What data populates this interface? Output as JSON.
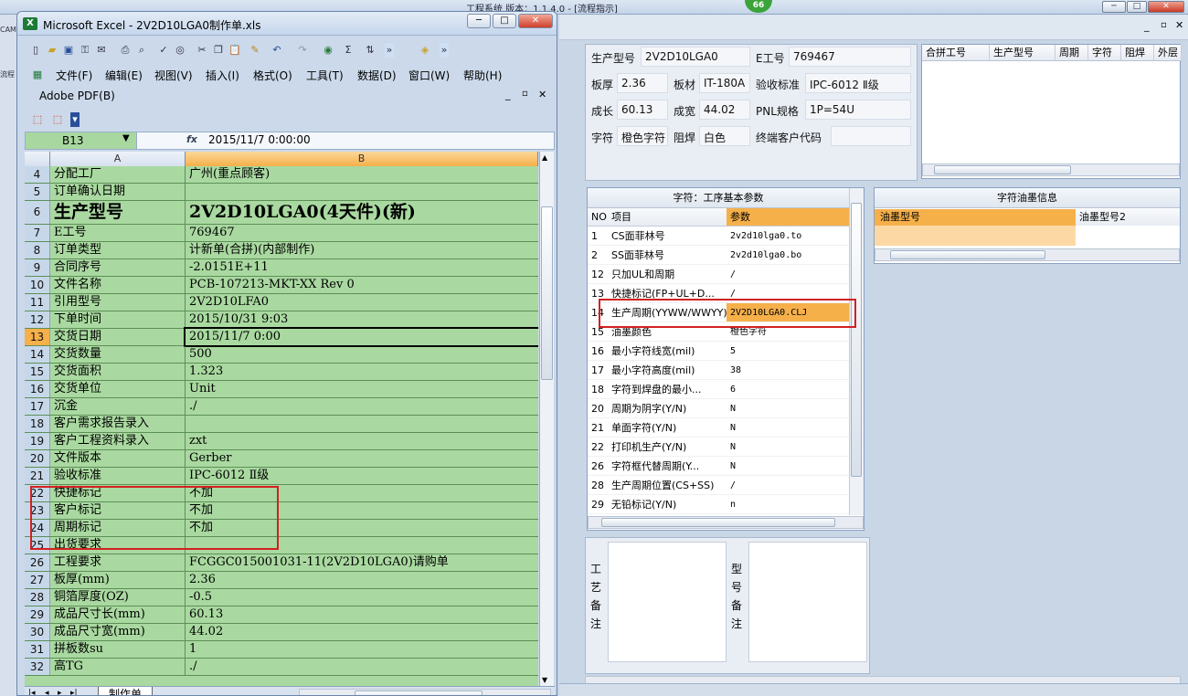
{
  "app": {
    "title": "工程系统   版本：1.1.4.0 - [流程指示]",
    "badge": "66",
    "left_labels": [
      "CAM",
      "流程"
    ]
  },
  "excel": {
    "title": "Microsoft Excel - 2V2D10LGA0制作单.xls",
    "menus": [
      "文件(F)",
      "编辑(E)",
      "视图(V)",
      "插入(I)",
      "格式(O)",
      "工具(T)",
      "数据(D)",
      "窗口(W)",
      "帮助(H)"
    ],
    "adobe": "Adobe PDF(B)",
    "name_box": "B13",
    "formula_value": "2015/11/7  0:00:00",
    "columns": [
      "A",
      "B"
    ],
    "sheet_tab": "制作单",
    "rows": [
      {
        "n": "4",
        "a": "分配工厂",
        "b": "广州(重点顾客)"
      },
      {
        "n": "5",
        "a": "订单确认日期",
        "b": ""
      },
      {
        "n": "6",
        "a": "生产型号",
        "b": "2V2D10LGA0(4天件)(新)"
      },
      {
        "n": "7",
        "a": "E工号",
        "b": "769467"
      },
      {
        "n": "8",
        "a": "订单类型",
        "b": "计新单(合拼)(内部制作)"
      },
      {
        "n": "9",
        "a": "合同序号",
        "b": "-2.0151E+11"
      },
      {
        "n": "10",
        "a": "文件名称",
        "b": "PCB-107213-MKT-XX Rev 0"
      },
      {
        "n": "11",
        "a": "引用型号",
        "b": "2V2D10LFA0"
      },
      {
        "n": "12",
        "a": "下单时间",
        "b": "2015/10/31 9:03"
      },
      {
        "n": "13",
        "a": "交货日期",
        "b": "2015/11/7 0:00"
      },
      {
        "n": "14",
        "a": "交货数量",
        "b": "500"
      },
      {
        "n": "15",
        "a": "交货面积",
        "b": "1.323"
      },
      {
        "n": "16",
        "a": "交货单位",
        "b": "Unit"
      },
      {
        "n": "17",
        "a": "沉金",
        "b": "./"
      },
      {
        "n": "18",
        "a": "客户需求报告录入",
        "b": ""
      },
      {
        "n": "19",
        "a": "客户工程资料录入",
        "b": "zxt"
      },
      {
        "n": "20",
        "a": "文件版本",
        "b": "Gerber"
      },
      {
        "n": "21",
        "a": "验收标准",
        "b": "IPC-6012 Ⅱ级"
      },
      {
        "n": "22",
        "a": "快捷标记",
        "b": "不加"
      },
      {
        "n": "23",
        "a": "客户标记",
        "b": "不加"
      },
      {
        "n": "24",
        "a": "周期标记",
        "b": "不加"
      },
      {
        "n": "25",
        "a": "出货要求",
        "b": ""
      },
      {
        "n": "26",
        "a": "工程要求",
        "b": "FCGGC015001031-11(2V2D10LGA0)请购单"
      },
      {
        "n": "27",
        "a": "板厚(mm)",
        "b": "2.36"
      },
      {
        "n": "28",
        "a": "铜箔厚度(OZ)",
        "b": "-0.5"
      },
      {
        "n": "29",
        "a": "成品尺寸长(mm)",
        "b": "60.13"
      },
      {
        "n": "30",
        "a": "成品尺寸宽(mm)",
        "b": "44.02"
      },
      {
        "n": "31",
        "a": "拼板数su",
        "b": "1"
      },
      {
        "n": "32",
        "a": "高TG",
        "b": "./"
      }
    ]
  },
  "info": {
    "model_label": "生产型号",
    "model": "2V2D10LGA0",
    "e_label": "E工号",
    "e_no": "769467",
    "thick_label": "板厚",
    "thick": "2.36",
    "mat_label": "板材",
    "mat": "IT-180A",
    "std_label": "验收标准",
    "std": "IPC-6012 Ⅱ级",
    "len_label": "成长",
    "len": "60.13",
    "wid_label": "成宽",
    "wid": "44.02",
    "pnl_label": "PNL规格",
    "pnl": "1P=54U",
    "char_label": "字符",
    "char": "橙色字符",
    "mask_label": "阻焊",
    "mask": "白色",
    "cust_label": "终端客户代码",
    "cust": ""
  },
  "combo": {
    "headers": [
      "合拼工号",
      "生产型号",
      "周期",
      "字符",
      "阻焊",
      "外层"
    ]
  },
  "params": {
    "title": "字符：工序基本参数",
    "col_no": "NO",
    "col_item": "项目",
    "col_param": "参数",
    "rows": [
      {
        "no": "1",
        "name": "CS面菲林号",
        "val": "2v2d10lga0.to"
      },
      {
        "no": "2",
        "name": "SS面菲林号",
        "val": "2v2d10lga0.bo"
      },
      {
        "no": "12",
        "name": "只加UL和周期",
        "val": "/"
      },
      {
        "no": "13",
        "name": "快捷标记(FP+UL+D...",
        "val": "/"
      },
      {
        "no": "14",
        "name": "生产周期(YYWW/WWYY)",
        "val": "2V2D10LGA0.CLJ"
      },
      {
        "no": "15",
        "name": "油墨颜色",
        "val": "橙色字符"
      },
      {
        "no": "16",
        "name": "最小字符线宽(mil)",
        "val": "5"
      },
      {
        "no": "17",
        "name": "最小字符高度(mil)",
        "val": "38"
      },
      {
        "no": "18",
        "name": "字符到焊盘的最小...",
        "val": "6"
      },
      {
        "no": "20",
        "name": "周期为阴字(Y/N)",
        "val": "N"
      },
      {
        "no": "21",
        "name": "单面字符(Y/N)",
        "val": "N"
      },
      {
        "no": "22",
        "name": "打印机生产(Y/N)",
        "val": "N"
      },
      {
        "no": "26",
        "name": "字符框代替周期(Y...",
        "val": "N"
      },
      {
        "no": "28",
        "name": "生产周期位置(CS+SS)",
        "val": "/"
      },
      {
        "no": "29",
        "name": "无铅标记(Y/N)",
        "val": "n"
      }
    ]
  },
  "ink": {
    "title": "字符油墨信息",
    "col1": "油墨型号",
    "col2": "油墨型号2"
  },
  "notes": {
    "process_label": [
      "工",
      "艺",
      "备",
      "注"
    ],
    "model_label": [
      "型",
      "号",
      "备",
      "注"
    ]
  },
  "colors": {
    "grid_green": "#a9d9a0",
    "selected_orange": "#f6b04a",
    "highlight_red": "#d32020"
  }
}
